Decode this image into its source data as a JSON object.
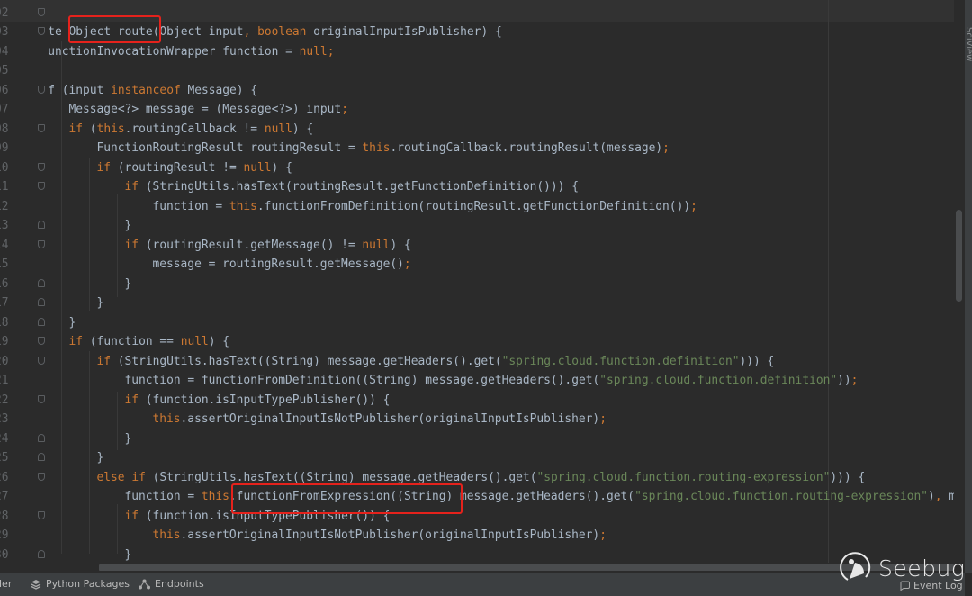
{
  "editor": {
    "lines": [
      {
        "num": "02",
        "indent": 0,
        "text": "",
        "fold": "start"
      },
      {
        "num": "03",
        "indent": 1,
        "text": "te Object route(Object input, boolean originalInputIsPublisher) {",
        "fold": "start"
      },
      {
        "num": "04",
        "indent": 1,
        "text": "unctionInvocationWrapper function = null;"
      },
      {
        "num": "05",
        "indent": 0,
        "text": ""
      },
      {
        "num": "06",
        "indent": 1,
        "text": "f (input instanceof Message) {",
        "fold": "start"
      },
      {
        "num": "07",
        "indent": 4,
        "text": "Message<?> message = (Message<?>) input;"
      },
      {
        "num": "08",
        "indent": 4,
        "text": "if (this.routingCallback != null) {",
        "fold": "start"
      },
      {
        "num": "09",
        "indent": 8,
        "text": "FunctionRoutingResult routingResult = this.routingCallback.routingResult(message);"
      },
      {
        "num": "10",
        "indent": 8,
        "text": "if (routingResult != null) {",
        "fold": "start"
      },
      {
        "num": "11",
        "indent": 12,
        "text": "if (StringUtils.hasText(routingResult.getFunctionDefinition())) {",
        "fold": "start"
      },
      {
        "num": "12",
        "indent": 16,
        "text": "function = this.functionFromDefinition(routingResult.getFunctionDefinition());"
      },
      {
        "num": "13",
        "indent": 12,
        "text": "}",
        "fold": "end"
      },
      {
        "num": "14",
        "indent": 12,
        "text": "if (routingResult.getMessage() != null) {",
        "fold": "start"
      },
      {
        "num": "15",
        "indent": 16,
        "text": "message = routingResult.getMessage();"
      },
      {
        "num": "16",
        "indent": 12,
        "text": "}",
        "fold": "end"
      },
      {
        "num": "17",
        "indent": 8,
        "text": "}",
        "fold": "end"
      },
      {
        "num": "18",
        "indent": 4,
        "text": "}",
        "fold": "end"
      },
      {
        "num": "19",
        "indent": 4,
        "text": "if (function == null) {",
        "fold": "start"
      },
      {
        "num": "20",
        "indent": 8,
        "text": "if (StringUtils.hasText((String) message.getHeaders().get(\"spring.cloud.function.definition\"))) {",
        "fold": "start"
      },
      {
        "num": "21",
        "indent": 12,
        "text": "function = functionFromDefinition((String) message.getHeaders().get(\"spring.cloud.function.definition\"));"
      },
      {
        "num": "22",
        "indent": 12,
        "text": "if (function.isInputTypePublisher()) {",
        "fold": "start"
      },
      {
        "num": "23",
        "indent": 16,
        "text": "this.assertOriginalInputIsNotPublisher(originalInputIsPublisher);"
      },
      {
        "num": "24",
        "indent": 12,
        "text": "}",
        "fold": "end"
      },
      {
        "num": "25",
        "indent": 8,
        "text": "}",
        "fold": "end"
      },
      {
        "num": "26",
        "indent": 8,
        "text": "else if (StringUtils.hasText((String) message.getHeaders().get(\"spring.cloud.function.routing-expression\"))) {",
        "fold": "start"
      },
      {
        "num": "27",
        "indent": 12,
        "text": "function = this.functionFromExpression((String) message.getHeaders().get(\"spring.cloud.function.routing-expression\"), m"
      },
      {
        "num": "28",
        "indent": 12,
        "text": "if (function.isInputTypePublisher()) {",
        "fold": "start"
      },
      {
        "num": "29",
        "indent": 16,
        "text": "this.assertOriginalInputIsNotPublisher(originalInputIsPublisher);"
      },
      {
        "num": "30",
        "indent": 12,
        "text": "}",
        "fold": "end"
      },
      {
        "num": "31",
        "indent": 8,
        "text": "}",
        "fold": "end"
      }
    ],
    "keywords": [
      "if",
      "else",
      "this",
      "null",
      "boolean",
      "instanceof",
      "new",
      "return"
    ],
    "colors": {
      "keyword": "#cc7832",
      "string": "#6a8759",
      "default": "#a9b7c6",
      "highlight_box": "#e5221c"
    }
  },
  "right_panel": {
    "label": "SciView"
  },
  "statusbar": {
    "items": [
      {
        "label": "ler",
        "icon": "tool-window-icon"
      },
      {
        "label": "Python Packages",
        "icon": "layers-icon"
      },
      {
        "label": "Endpoints",
        "icon": "endpoints-icon"
      }
    ],
    "event_log": "Event Log"
  },
  "watermark": {
    "text": "Seebug"
  }
}
